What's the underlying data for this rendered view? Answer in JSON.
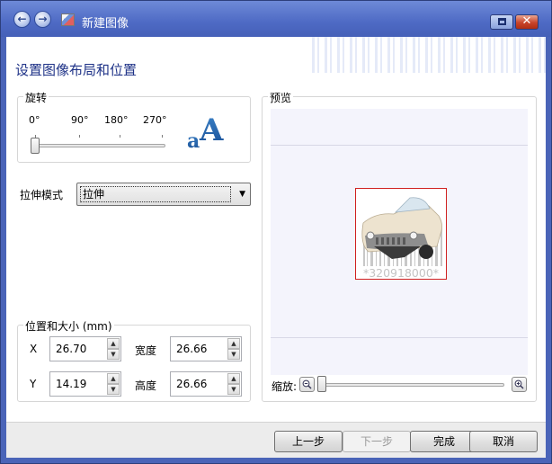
{
  "window": {
    "title": "新建图像"
  },
  "page": {
    "heading": "设置图像布局和位置"
  },
  "rotation": {
    "legend": "旋转",
    "angles": [
      "0°",
      "90°",
      "180°",
      "270°"
    ],
    "value_degrees": 0
  },
  "stretch": {
    "label": "拉伸模式",
    "value": "拉伸"
  },
  "position_size": {
    "legend": "位置和大小 (mm)",
    "x_label": "X",
    "x_value": "26.70",
    "y_label": "Y",
    "y_value": "14.19",
    "width_label": "宽度",
    "width_value": "26.66",
    "height_label": "高度",
    "height_value": "26.66"
  },
  "preview": {
    "legend": "预览",
    "barcode_text": "*320918000*",
    "zoom_label": "缩放:"
  },
  "buttons": {
    "prev": "上一步",
    "next": "下一步",
    "finish": "完成",
    "cancel": "取消"
  },
  "colors": {
    "heading": "#1e3287",
    "selection": "#d02020",
    "titlebar": "#4e6ac4"
  }
}
